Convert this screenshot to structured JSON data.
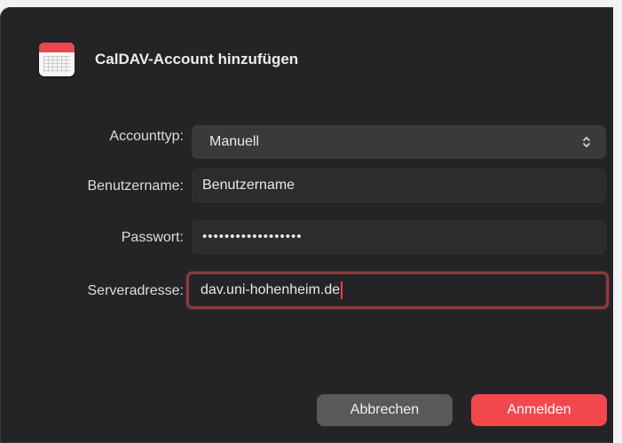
{
  "dialog": {
    "title": "CalDAV-Account hinzufügen",
    "icon": "calendar-icon"
  },
  "form": {
    "account_type_label": "Accounttyp:",
    "account_type_value": "Manuell",
    "username_label": "Benutzername:",
    "username_placeholder": "Benutzername",
    "password_label": "Passwort:",
    "password_value": "••••••••••••••••••",
    "server_label": "Serveradresse:",
    "server_value": "dav.uni-hohenheim.de"
  },
  "buttons": {
    "cancel": "Abbrechen",
    "confirm": "Anmelden"
  },
  "colors": {
    "background": "#242427",
    "accent": "#f2474d",
    "focus_ring": "#8a3c41"
  }
}
